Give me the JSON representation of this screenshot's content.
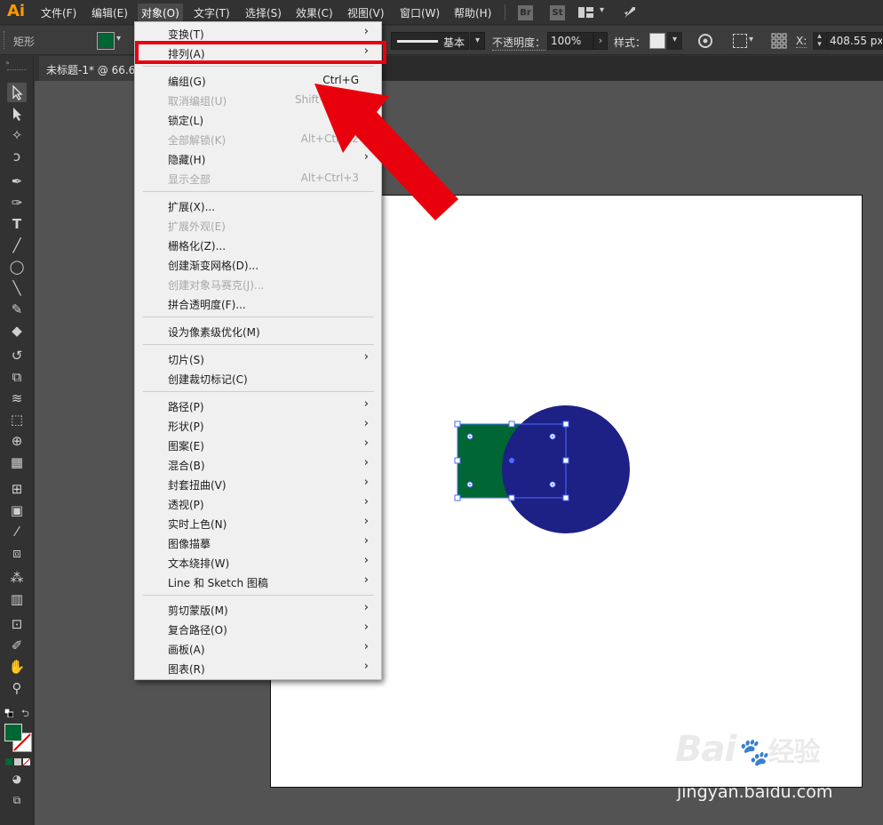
{
  "app": {
    "logo": "Ai"
  },
  "menubar": {
    "items": [
      "文件(F)",
      "编辑(E)",
      "对象(O)",
      "文字(T)",
      "选择(S)",
      "效果(C)",
      "视图(V)",
      "窗口(W)",
      "帮助(H)"
    ],
    "bridge_label": "Br",
    "stock_label": "St"
  },
  "control_bar": {
    "object_type": "矩形",
    "fill_color": "#006633",
    "stroke_style": "基本",
    "opacity_label": "不透明度：",
    "opacity_value": "100%",
    "style_label": "样式：",
    "x_label": "X:",
    "x_value": "408.55 px"
  },
  "document_tab": {
    "label": "未标题-1* @ 66.6"
  },
  "object_menu": {
    "sections": [
      [
        {
          "label": "变换(T)",
          "shortcut": "",
          "submenu": true,
          "disabled": false
        },
        {
          "label": "排列(A)",
          "shortcut": "",
          "submenu": true,
          "disabled": false
        }
      ],
      [
        {
          "label": "编组(G)",
          "shortcut": "Ctrl+G",
          "submenu": false,
          "disabled": false
        },
        {
          "label": "取消编组(U)",
          "shortcut": "Shift+Ctrl+G",
          "submenu": false,
          "disabled": true
        },
        {
          "label": "锁定(L)",
          "shortcut": "",
          "submenu": true,
          "disabled": false
        },
        {
          "label": "全部解锁(K)",
          "shortcut": "Alt+Ctrl+2",
          "submenu": false,
          "disabled": true
        },
        {
          "label": "隐藏(H)",
          "shortcut": "",
          "submenu": true,
          "disabled": false
        },
        {
          "label": "显示全部",
          "shortcut": "Alt+Ctrl+3",
          "submenu": false,
          "disabled": true
        }
      ],
      [
        {
          "label": "扩展(X)...",
          "shortcut": "",
          "submenu": false,
          "disabled": false
        },
        {
          "label": "扩展外观(E)",
          "shortcut": "",
          "submenu": false,
          "disabled": true
        },
        {
          "label": "栅格化(Z)...",
          "shortcut": "",
          "submenu": false,
          "disabled": false
        },
        {
          "label": "创建渐变网格(D)...",
          "shortcut": "",
          "submenu": false,
          "disabled": false
        },
        {
          "label": "创建对象马赛克(J)...",
          "shortcut": "",
          "submenu": false,
          "disabled": true
        },
        {
          "label": "拼合透明度(F)...",
          "shortcut": "",
          "submenu": false,
          "disabled": false
        }
      ],
      [
        {
          "label": "设为像素级优化(M)",
          "shortcut": "",
          "submenu": false,
          "disabled": false
        }
      ],
      [
        {
          "label": "切片(S)",
          "shortcut": "",
          "submenu": true,
          "disabled": false
        },
        {
          "label": "创建裁切标记(C)",
          "shortcut": "",
          "submenu": false,
          "disabled": false
        }
      ],
      [
        {
          "label": "路径(P)",
          "shortcut": "",
          "submenu": true,
          "disabled": false
        },
        {
          "label": "形状(P)",
          "shortcut": "",
          "submenu": true,
          "disabled": false
        },
        {
          "label": "图案(E)",
          "shortcut": "",
          "submenu": true,
          "disabled": false
        },
        {
          "label": "混合(B)",
          "shortcut": "",
          "submenu": true,
          "disabled": false
        },
        {
          "label": "封套扭曲(V)",
          "shortcut": "",
          "submenu": true,
          "disabled": false
        },
        {
          "label": "透视(P)",
          "shortcut": "",
          "submenu": true,
          "disabled": false
        },
        {
          "label": "实时上色(N)",
          "shortcut": "",
          "submenu": true,
          "disabled": false
        },
        {
          "label": "图像描摹",
          "shortcut": "",
          "submenu": true,
          "disabled": false
        },
        {
          "label": "文本绕排(W)",
          "shortcut": "",
          "submenu": true,
          "disabled": false
        },
        {
          "label": "Line 和 Sketch 图稿",
          "shortcut": "",
          "submenu": true,
          "disabled": false
        }
      ],
      [
        {
          "label": "剪切蒙版(M)",
          "shortcut": "",
          "submenu": true,
          "disabled": false
        },
        {
          "label": "复合路径(O)",
          "shortcut": "",
          "submenu": true,
          "disabled": false
        },
        {
          "label": "画板(A)",
          "shortcut": "",
          "submenu": true,
          "disabled": false
        },
        {
          "label": "图表(R)",
          "shortcut": "",
          "submenu": true,
          "disabled": false
        }
      ]
    ]
  },
  "artwork": {
    "rect_color": "#006633",
    "circle_color": "#1d2085",
    "selection_color": "#4a6cff"
  },
  "annotation": {
    "color": "#e8000c"
  },
  "watermark": {
    "brand": "Bai",
    "brand_cn": "经验",
    "url": "jingyan.baidu.com"
  }
}
